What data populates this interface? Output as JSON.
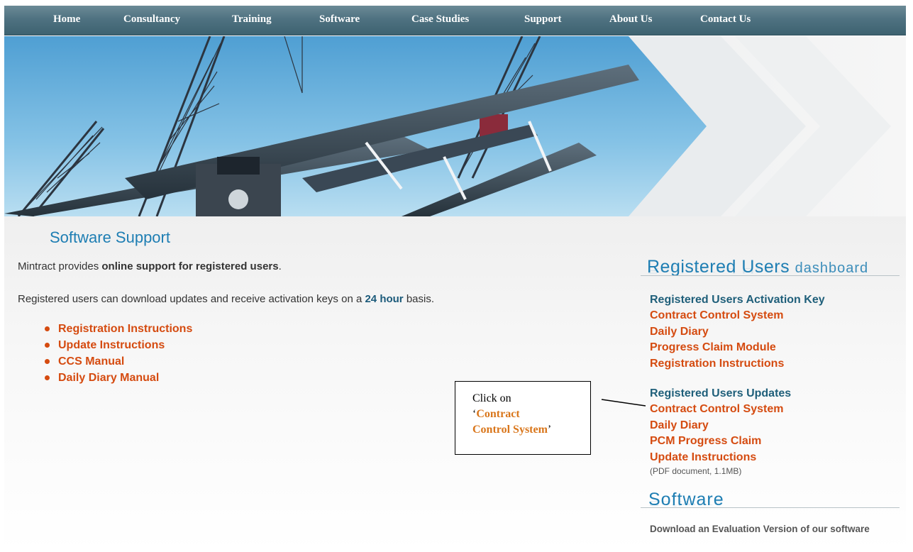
{
  "nav": {
    "items": [
      "Home",
      "Consultancy",
      "Training",
      "Software",
      "Case Studies",
      "Support",
      "About Us",
      "Contact Us"
    ]
  },
  "main": {
    "title": "Software Support",
    "intro_prefix": "Mintract provides ",
    "intro_bold": "online support for registered users",
    "intro_suffix": ".",
    "intro2_prefix": "Registered users can download updates and receive activation keys on a ",
    "intro2_bold": "24 hour",
    "intro2_suffix": " basis.",
    "documents": [
      "Registration Instructions",
      "Update Instructions",
      "CCS Manual",
      "Daily Diary Manual"
    ]
  },
  "callout": {
    "line1": "Click on",
    "open_quote": "‘",
    "highlight_line1": "Contract",
    "highlight_line2": "Control System",
    "close_quote": "’"
  },
  "sidebar": {
    "heading_main": "Registered Users",
    "heading_light": "dashboard",
    "activation": {
      "title": "Registered Users Activation Key",
      "links": [
        "Contract Control System",
        "Daily Diary",
        "Progress Claim Module",
        "Registration Instructions"
      ]
    },
    "updates": {
      "title": "Registered Users Updates",
      "links": [
        "Contract Control System",
        "Daily Diary",
        "PCM Progress Claim",
        "Update Instructions"
      ]
    },
    "pdf_note": "(PDF document, 1.1MB)",
    "software_heading": "Software",
    "evaluation_text": "Download an Evaluation Version of our software"
  },
  "colors": {
    "accent_blue": "#1e7eb3",
    "link_orange": "#d54b10",
    "nav_bg": "#4f7281"
  }
}
